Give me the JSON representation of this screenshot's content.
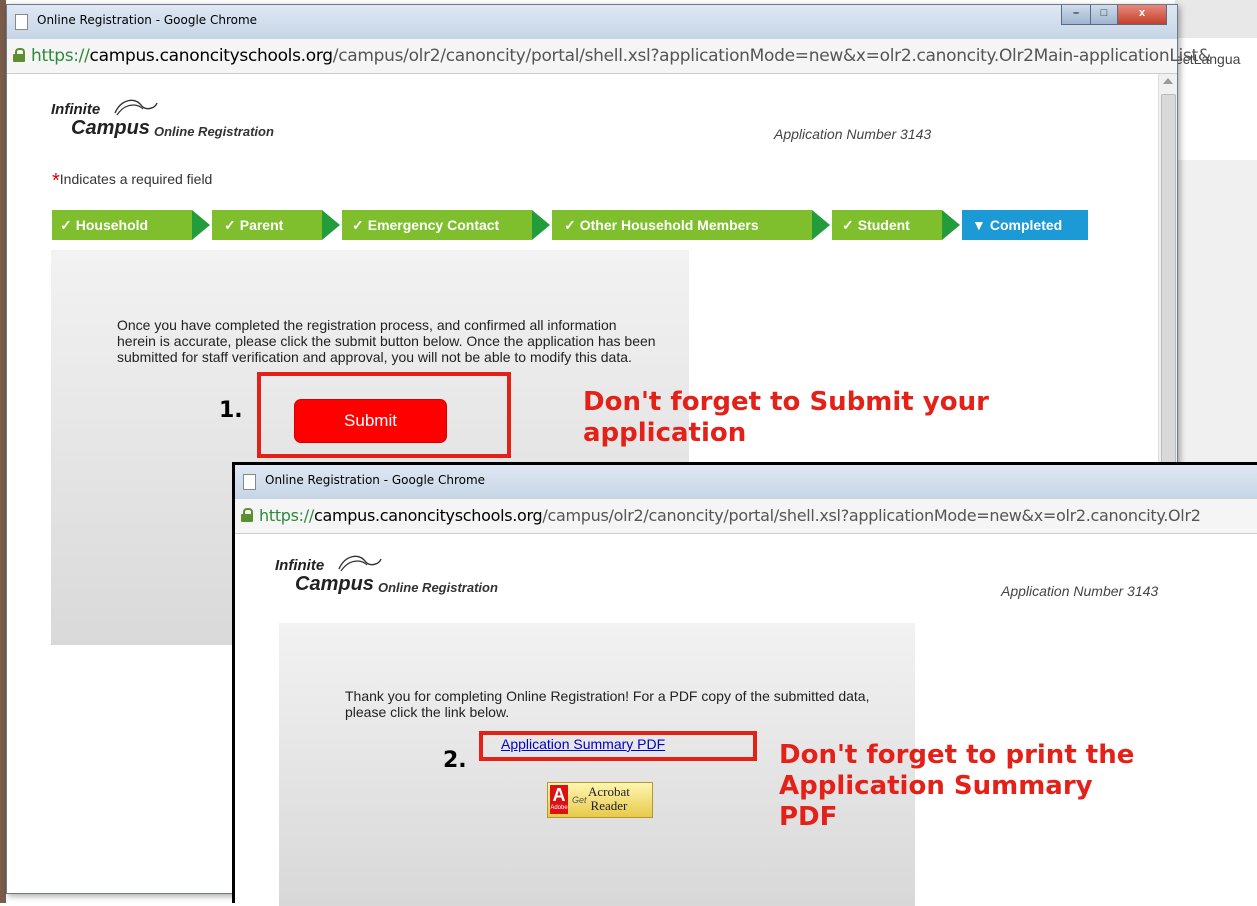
{
  "background": {
    "url_fragment": "ectLangua"
  },
  "window1": {
    "title": "Online Registration - Google Chrome",
    "url": {
      "scheme": "https://",
      "host": "campus.canoncityschools.org",
      "path": "/campus/olr2/canoncity/portal/shell.xsl?applicationMode=new&x=olr2.canoncity.Olr2Main-applicationList&"
    },
    "logo": {
      "infinite": "Infinite",
      "campus": "Campus",
      "product": "Online Registration"
    },
    "application_number": "Application Number 3143",
    "required_note": "Indicates a required field",
    "steps": [
      {
        "label": "Household",
        "state": "complete"
      },
      {
        "label": "Parent",
        "state": "complete"
      },
      {
        "label": "Emergency Contact",
        "state": "complete"
      },
      {
        "label": "Other Household Members",
        "state": "complete"
      },
      {
        "label": "Student",
        "state": "complete"
      },
      {
        "label": "Completed",
        "state": "current"
      }
    ],
    "instructions": "Once you have completed the registration process, and confirmed all information herein is accurate, please click the submit button below. Once the application has been submitted for staff verification and approval, you will not be able to modify this data.",
    "step_number": "1.",
    "submit_label": "Submit",
    "callout": [
      "Don't forget to Submit your",
      "application"
    ]
  },
  "window2": {
    "title": "Online Registration - Google Chrome",
    "url": {
      "scheme": "https://",
      "host": "campus.canoncityschools.org",
      "path": "/campus/olr2/canoncity/portal/shell.xsl?applicationMode=new&x=olr2.canoncity.Olr2"
    },
    "logo": {
      "infinite": "Infinite",
      "campus": "Campus",
      "product": "Online Registration"
    },
    "application_number": "Application Number 3143",
    "message": "Thank you for completing Online Registration! For a PDF copy of the submitted data, please click the link below.",
    "step_number": "2.",
    "pdf_link": "Application Summary PDF",
    "acrobat": {
      "adobe": "Adobe",
      "get": "Get",
      "line1": "Acrobat",
      "line2": "Reader"
    },
    "callout": [
      "Don't forget to print the",
      "Application Summary",
      "PDF"
    ]
  },
  "colors": {
    "step_green": "#7fbf2e",
    "step_blue": "#1b9ad6",
    "callout_red": "#e32119",
    "submit_red": "#ff0000",
    "link_blue": "#0000cc"
  }
}
